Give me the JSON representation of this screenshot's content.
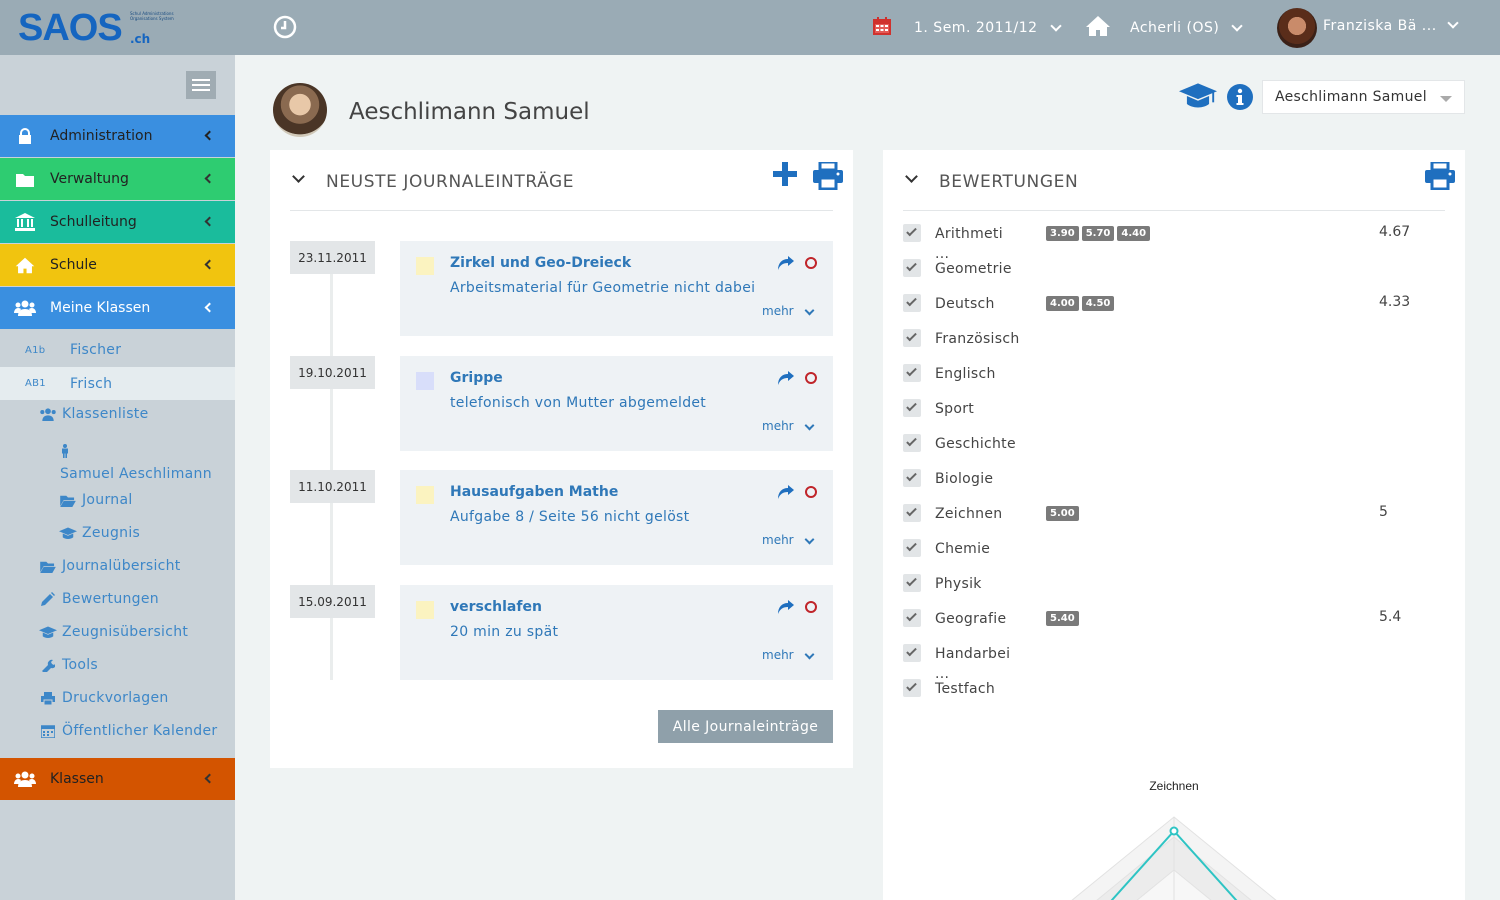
{
  "app": {
    "logo_text": "SAOS",
    "logo_tld": ".ch",
    "logo_small": "Schul Administrations Organisations System"
  },
  "topbar": {
    "semester": "1. Sem. 2011/12",
    "school": "Acherli (OS)",
    "user": "Franziska Bä ..."
  },
  "sidebar": {
    "menus": [
      {
        "label": "Administration",
        "color": "#3a8fe0"
      },
      {
        "label": "Verwaltung",
        "color": "#2ecc71"
      },
      {
        "label": "Schulleitung",
        "color": "#1abc9c"
      },
      {
        "label": "Schule",
        "color": "#f1c40f"
      },
      {
        "label": "Meine Klassen",
        "color": "#3a8fe0"
      }
    ],
    "classes": [
      {
        "code": "A1b",
        "name": "Fischer"
      },
      {
        "code": "AB1",
        "name": "Frisch"
      }
    ],
    "items": {
      "klassenliste": "Klassenliste",
      "student": "Samuel Aeschlimann",
      "journal": "Journal",
      "zeugnis": "Zeugnis",
      "journaluebersicht": "Journalübersicht",
      "bewertungen": "Bewertungen",
      "zeugnisuebersicht": "Zeugnisübersicht",
      "tools": "Tools",
      "druckvorlagen": "Druckvorlagen",
      "kalender": "Öffentlicher Kalender"
    },
    "bottom_menu": {
      "label": "Klassen",
      "color": "#d35400"
    }
  },
  "student": {
    "name": "Aeschlimann Samuel",
    "select_value": "Aeschlimann Samuel"
  },
  "journal": {
    "title": "NEUSTE JOURNALEINTRÄGE",
    "more_label": "mehr",
    "all_button": "Alle Journaleinträge",
    "entries": [
      {
        "date": "23.11.2011",
        "title": "Zirkel und Geo-Dreieck",
        "desc": "Arbeitsmaterial für Geometrie nicht dabei",
        "color": "#fbf3c0"
      },
      {
        "date": "19.10.2011",
        "title": "Grippe",
        "desc": "telefonisch von Mutter abgemeldet",
        "color": "#d8defa"
      },
      {
        "date": "11.10.2011",
        "title": "Hausaufgaben Mathe",
        "desc": "Aufgabe 8 / Seite 56 nicht gelöst",
        "color": "#fbf3c0"
      },
      {
        "date": "15.09.2011",
        "title": "verschlafen",
        "desc": "20 min zu spät",
        "color": "#fbf3c0"
      }
    ]
  },
  "grades": {
    "title": "BEWERTUNGEN",
    "subjects": [
      {
        "name": "Arithmeti\n...",
        "badges": [
          "3.90",
          "5.70",
          "4.40"
        ],
        "avg": "4.67"
      },
      {
        "name": "Geometrie",
        "badges": [],
        "avg": ""
      },
      {
        "name": "Deutsch",
        "badges": [
          "4.00",
          "4.50"
        ],
        "avg": "4.33"
      },
      {
        "name": "Französisch",
        "badges": [],
        "avg": ""
      },
      {
        "name": "Englisch",
        "badges": [],
        "avg": ""
      },
      {
        "name": "Sport",
        "badges": [],
        "avg": ""
      },
      {
        "name": "Geschichte",
        "badges": [],
        "avg": ""
      },
      {
        "name": "Biologie",
        "badges": [],
        "avg": ""
      },
      {
        "name": "Zeichnen",
        "badges": [
          "5.00"
        ],
        "avg": "5"
      },
      {
        "name": "Chemie",
        "badges": [],
        "avg": ""
      },
      {
        "name": "Physik",
        "badges": [],
        "avg": ""
      },
      {
        "name": "Geografie",
        "badges": [
          "5.40"
        ],
        "avg": "5.4"
      },
      {
        "name": "Handarbei\n...",
        "badges": [],
        "avg": ""
      },
      {
        "name": "Testfach",
        "badges": [],
        "avg": ""
      }
    ],
    "radar_label": "Zeichnen"
  }
}
